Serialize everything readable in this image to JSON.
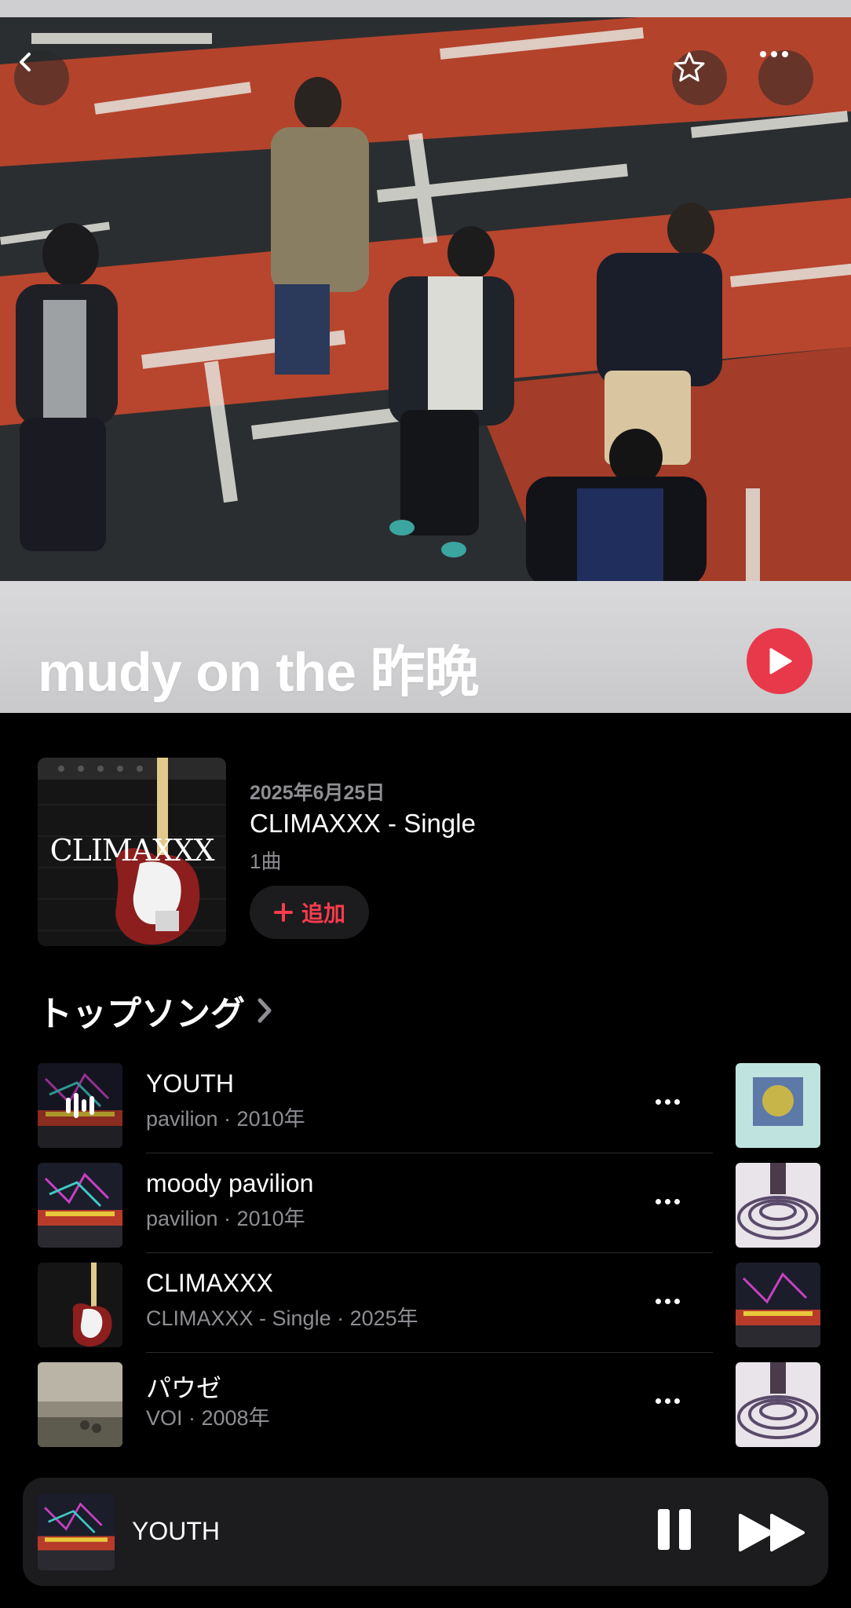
{
  "header": {
    "artist_name": "mudy on the 昨晩",
    "back_icon": "chevron-left-icon",
    "favorite_icon": "star-icon",
    "more_icon": "ellipsis-icon",
    "play_icon": "play-icon"
  },
  "latest_release": {
    "date": "2025年6月25日",
    "title": "CLIMAXXX - Single",
    "track_count": "1曲",
    "add_label": "追加",
    "artwork_text": "CLIMAXXX"
  },
  "top_songs": {
    "section_title": "トップソング",
    "items": [
      {
        "title": "YOUTH",
        "subtitle": "pavilion · 2010年",
        "now_playing": true
      },
      {
        "title": "moody pavilion",
        "subtitle": "pavilion · 2010年"
      },
      {
        "title": "CLIMAXXX",
        "subtitle": "CLIMAXXX - Single · 2025年"
      },
      {
        "title": "パウゼ",
        "subtitle": "VOI · 2008年"
      }
    ]
  },
  "mini_player": {
    "title": "YOUTH"
  },
  "colors": {
    "accent": "#fa3c4c",
    "play_button": "#e8394a",
    "background": "#000000",
    "secondary_text": "#8e8e93"
  }
}
